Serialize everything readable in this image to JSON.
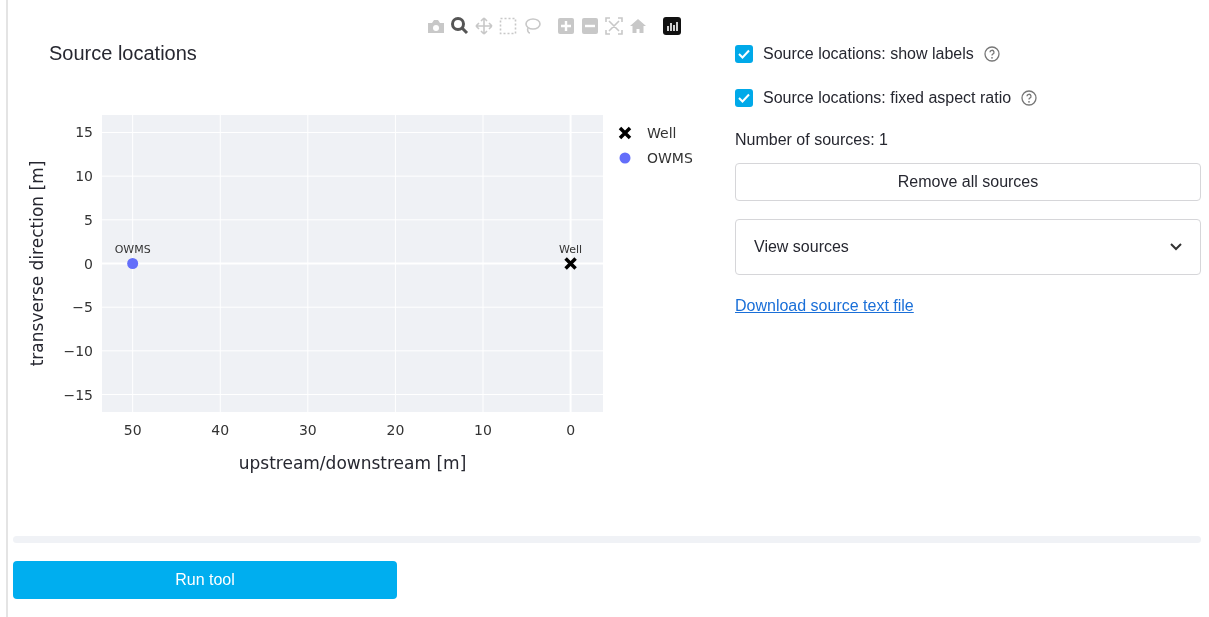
{
  "modebar": [
    {
      "kind": "camera",
      "selected": false
    },
    {
      "kind": "zoom",
      "selected": true
    },
    {
      "kind": "pan",
      "selected": false
    },
    {
      "kind": "box-select",
      "selected": false
    },
    {
      "kind": "lasso",
      "selected": false
    },
    {
      "kind": "zoom-in",
      "selected": false
    },
    {
      "kind": "zoom-out",
      "selected": false
    },
    {
      "kind": "autoscale",
      "selected": false
    },
    {
      "kind": "home",
      "selected": false
    },
    {
      "kind": "logo",
      "selected": false
    }
  ],
  "chart": {
    "chart_data": {
      "type": "scatter",
      "title": "Source locations",
      "xlabel": "upstream/downstream [m]",
      "ylabel": "transverse direction [m]",
      "series": [
        {
          "name": "Well",
          "color": "#000000",
          "x": [
            0
          ],
          "values": [
            0
          ]
        },
        {
          "name": "OWMS",
          "color": "#636efa",
          "x": [
            50
          ],
          "values": [
            0
          ]
        }
      ],
      "grid": true,
      "legend": true,
      "xlim": [
        53.5,
        -3.7
      ],
      "ylim": [
        -17,
        17
      ],
      "xticks": [
        50,
        40,
        30,
        20,
        10,
        0
      ],
      "yticks": [
        {
          "value": 15,
          "label": "15"
        },
        {
          "value": 10,
          "label": "10"
        },
        {
          "value": 5,
          "label": "5"
        },
        {
          "value": 0,
          "label": "0"
        },
        {
          "value": -5,
          "label": "−5"
        },
        {
          "value": -10,
          "label": "−10"
        },
        {
          "value": -15,
          "label": "−15"
        }
      ],
      "annotations": [
        {
          "text": "Well",
          "x": 0,
          "y": 0
        },
        {
          "text": "OWMS",
          "x": 50,
          "y": 0
        }
      ]
    }
  },
  "options": [
    {
      "label": "Source locations: show labels",
      "checked": true
    },
    {
      "label": "Source locations: fixed aspect ratio",
      "checked": true
    }
  ],
  "source_count": "Number of sources: 1",
  "remove_button": "Remove all sources",
  "expander": {
    "label": "View sources",
    "expanded": false
  },
  "download_link": "Download source text file",
  "run_button": "Run tool"
}
